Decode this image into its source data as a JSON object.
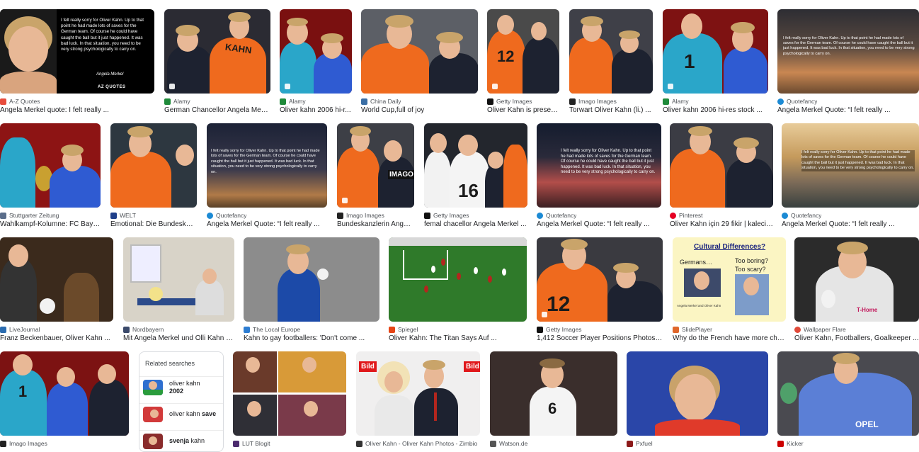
{
  "results": [
    {
      "source": "A-Z Quotes",
      "caption": "Angela Merkel quote: I felt really ...",
      "fav": "#e74c3c",
      "quote": "I felt really sorry for Oliver Kahn. Up to that point he had made lots of saves for the German team. Of course he could have caught the ball but it just happened. It was bad luck. In that situation, you need to be very strong psychologically to carry on.",
      "attribution": "Angela Merkel",
      "brand": "AZ QUOTES"
    },
    {
      "source": "Alamy",
      "caption": "German Chancellor Angela Merk...",
      "fav": "#1f8a3a"
    },
    {
      "source": "Alamy",
      "caption": "Oliver kahn 2006 hi-r...",
      "fav": "#1f8a3a"
    },
    {
      "source": "China Daily",
      "caption": "World Cup,full of joy",
      "fav": "#3a6ea5"
    },
    {
      "source": "Getty Images",
      "caption": "Oliver Kahn is presen...",
      "fav": "#111111"
    },
    {
      "source": "Imago Images",
      "caption": "Torwart Oliver Kahn (li.) ...",
      "fav": "#222222"
    },
    {
      "source": "Alamy",
      "caption": "Oliver kahn 2006 hi-res stock ...",
      "fav": "#1f8a3a"
    },
    {
      "source": "Quotefancy",
      "caption": "Angela Merkel Quote: “I felt really ...",
      "fav": "#1c8ad4"
    },
    {
      "source": "Stuttgarter Zeitung",
      "caption": "Wahlkampf-Kolumne: FC Baye...",
      "fav": "#5a6d8a"
    },
    {
      "source": "WELT",
      "caption": "Emotional: Die Bundeskan...",
      "fav": "#1f3f8a"
    },
    {
      "source": "Quotefancy",
      "caption": "Angela Merkel Quote: “I felt really ...",
      "fav": "#1c8ad4"
    },
    {
      "source": "Imago Images",
      "caption": "Bundeskanzlerin Angel...",
      "fav": "#222222"
    },
    {
      "source": "Getty Images",
      "caption": "femal chacellor Angela Merkel ...",
      "fav": "#111111"
    },
    {
      "source": "Quotefancy",
      "caption": "Angela Merkel Quote: “I felt really ...",
      "fav": "#1c8ad4"
    },
    {
      "source": "Pinterest",
      "caption": "Oliver Kahn için 29 fikir | kaleci ...",
      "fav": "#e60023"
    },
    {
      "source": "Quotefancy",
      "caption": "Angela Merkel Quote: “I felt really ...",
      "fav": "#1c8ad4"
    },
    {
      "source": "LiveJournal",
      "caption": "Franz Beckenbauer, Oliver Kahn ...",
      "fav": "#2b6cb0"
    },
    {
      "source": "Nordbayern",
      "caption": "Mit Angela Merkel und Olli Kahn in...",
      "fav": "#3b4a6b"
    },
    {
      "source": "The Local Europe",
      "caption": "Kahn to gay footballers: 'Don't come ...",
      "fav": "#2d7dd2"
    },
    {
      "source": "Spiegel",
      "caption": "Oliver Kahn: The Titan Says Auf ...",
      "fav": "#e64415"
    },
    {
      "source": "Getty Images",
      "caption": "1,412 Soccer Player Positions Photos ...",
      "fav": "#111111"
    },
    {
      "source": "SlidePlayer",
      "caption": "Why do the French have more chil...",
      "fav": "#e0672c"
    },
    {
      "source": "Wallpaper Flare",
      "caption": "Oliver Kahn, Footballers, Goalkeeper ...",
      "fav": "#e04a3a"
    },
    {
      "source": "Imago Images",
      "caption": "",
      "fav": "#222222"
    },
    {
      "source": "LUT Blogit",
      "caption": "",
      "fav": "#4b2a6e"
    },
    {
      "source": "Oliver Kahn - Oliver Kahn Photos - Zimbio",
      "caption": "",
      "fav": "#333333"
    },
    {
      "source": "Watson.de",
      "caption": "",
      "fav": "#555555"
    },
    {
      "source": "Pxfuel",
      "caption": "",
      "fav": "#8c1a1a"
    },
    {
      "source": "Kicker",
      "caption": "",
      "fav": "#cc0000"
    }
  ],
  "quote_short": "I felt really sorry for Oliver Kahn. Up to that point he had made lots of saves for the German team. Of course he could have caught the ball but it just happened. It was bad luck. In that situation, you need to be very strong psychologically to carry on.",
  "slide": {
    "title": "Cultural Differences?",
    "germans": "Germans…",
    "q1": "Too boring?",
    "q2": "Too scary?",
    "caption": "Angela Merkel and Oliver Kahn"
  },
  "jersey": {
    "a": "12",
    "b": "1",
    "c": "16",
    "d": "6",
    "name": "KAHN"
  },
  "related": {
    "title": "Related searches",
    "items": [
      {
        "text": "oliver kahn",
        "bold": "2002"
      },
      {
        "text": "oliver kahn",
        "bold": "save"
      },
      {
        "text": "svenja",
        "bold": "kahn"
      }
    ]
  },
  "badges": {
    "bild": "Bild",
    "imago": "IMAGO",
    "telekom": "T-Home",
    "opel": "OPEL"
  }
}
